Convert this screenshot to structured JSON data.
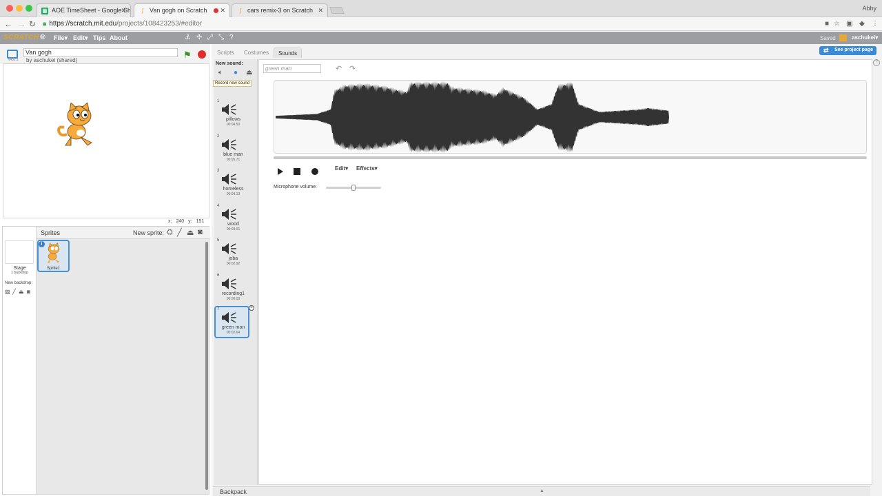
{
  "browser": {
    "tabs": [
      {
        "title": "AOE TimeSheet - Google Shee",
        "favicon": "sheets-icon",
        "active": false
      },
      {
        "title": "Van gogh on Scratch",
        "favicon": "scratch-icon",
        "active": true
      },
      {
        "title": "cars remix-3 on Scratch",
        "favicon": "scratch-icon",
        "active": false
      }
    ],
    "user": "Abby",
    "url_host": "https://scratch.mit.edu",
    "url_path": "/projects/108423253/#editor"
  },
  "menubar": {
    "logo": "SCRATCH",
    "file": "File▾",
    "edit": "Edit▾",
    "tips": "Tips",
    "about": "About",
    "saved": "Saved",
    "account": "aschukei▾"
  },
  "stage": {
    "version": "v452.1",
    "project_title": "Van gogh",
    "author": "by aschukei (shared)",
    "coords": {
      "x_label": "x:",
      "x": "240",
      "y_label": "y:",
      "y": "151"
    }
  },
  "sprites": {
    "header": "Sprites",
    "new_sprite": "New sprite:",
    "stage_label": "Stage",
    "backdrop_count": "1 backdrop",
    "new_backdrop": "New backdrop:",
    "sprite1": "Sprite1"
  },
  "editor": {
    "tabs": {
      "scripts": "Scripts",
      "costumes": "Costumes",
      "sounds": "Sounds"
    },
    "see_project": "See project page",
    "new_sound": "New sound:",
    "tooltip": "Record new sound",
    "sounds": [
      {
        "num": "1",
        "name": "pillows",
        "duration": "00:04.50"
      },
      {
        "num": "2",
        "name": "blue man",
        "duration": "00:05.71"
      },
      {
        "num": "3",
        "name": "homeless",
        "duration": "00:04.13"
      },
      {
        "num": "4",
        "name": "wood",
        "duration": "00:03.01"
      },
      {
        "num": "5",
        "name": "joba",
        "duration": "00:02.92"
      },
      {
        "num": "6",
        "name": "recording1",
        "duration": "00:00.00"
      },
      {
        "num": "7",
        "name": "green man",
        "duration": "00:02.64"
      }
    ],
    "sound_name_value": "green man",
    "edit_menu": "Edit▾",
    "effects_menu": "Effects▾",
    "mic_label": "Microphone volume:",
    "mic_volume_fraction": 0.5
  },
  "backpack": {
    "label": "Backpack"
  },
  "colors": {
    "accent": "#3b8ad6",
    "menubar": "#9c9ea2",
    "stop": "#e02c2c",
    "flag": "#3d8f2a"
  }
}
